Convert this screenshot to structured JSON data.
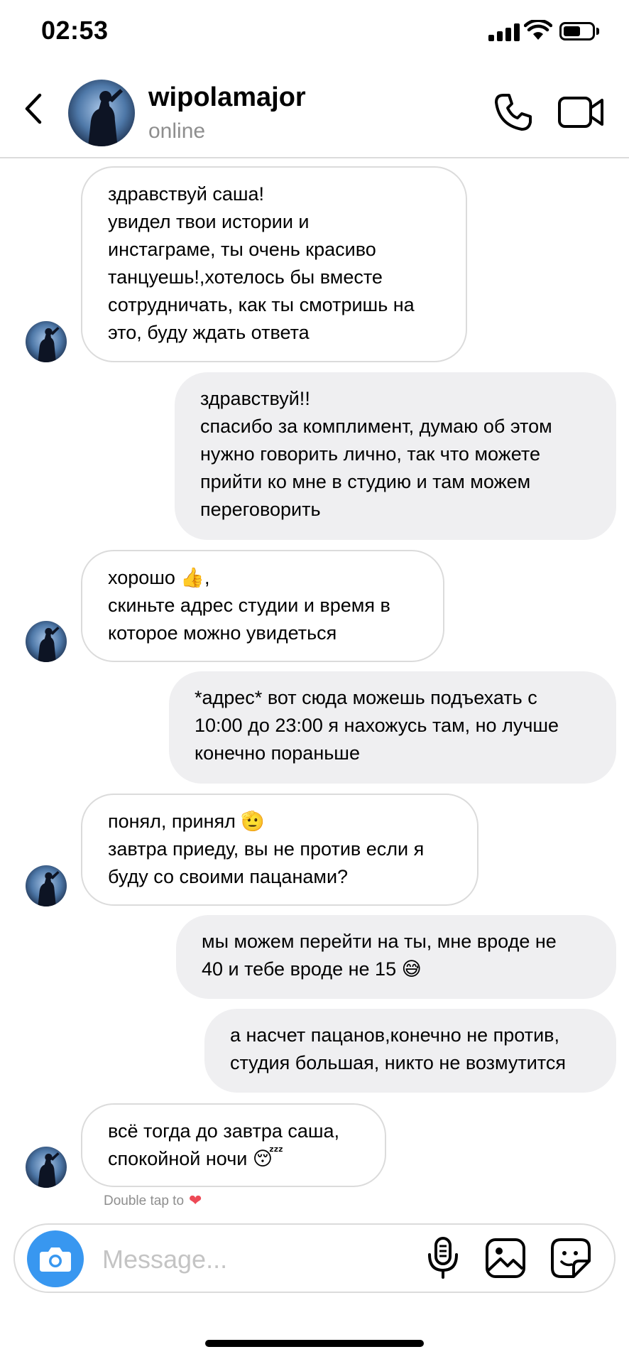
{
  "status_bar": {
    "time": "02:53",
    "battery_level": 0.6
  },
  "header": {
    "username": "wipolamajor",
    "presence": "online",
    "icons": [
      "back-chevron-icon",
      "phone-icon",
      "video-camera-icon"
    ]
  },
  "messages": [
    {
      "from": "them",
      "text": "здравствуй саша!\nувидел твои истории и\nинстаграме, ты очень красиво\nтанцуешь!,хотелось бы вместе\nсотрудничать, как ты смотришь на\nэто, буду ждать ответа"
    },
    {
      "from": "me",
      "text": "здравствуй!!\nспасибо за комплимент, думаю об этом\nнужно говорить лично, так что можете\nприйти ко мне в студию и там можем\nпереговорить"
    },
    {
      "from": "them",
      "text": "хорошо 👍,\nскиньте адрес студии и время в\nкоторое можно увидеться"
    },
    {
      "from": "me",
      "text": "*адрес* вот сюда можешь подъехать с\n10:00 до 23:00 я нахожусь там, но лучше\nконечно пораньше"
    },
    {
      "from": "them",
      "text": "понял, принял 🫡\nзавтра приеду, вы не против если я\nбуду со своими пацанами?"
    },
    {
      "from": "me",
      "text": "мы можем перейти на ты, мне вроде не\n40 и тебе вроде не 15 😅"
    },
    {
      "from": "me",
      "text": "а насчет пацанов,конечно не против,\nстудия большая, никто не возмутится"
    },
    {
      "from": "them",
      "text": "всё тогда до завтра саша,\nспокойной ночи 😴"
    }
  ],
  "double_tap_hint": "Double tap to",
  "heart_glyph": "❤",
  "composer": {
    "placeholder": "Message...",
    "icons": [
      "camera-icon",
      "microphone-icon",
      "gallery-icon",
      "sticker-icon"
    ]
  },
  "colors": {
    "accent": "#3897f0",
    "outgoing_bubble": "#efeff1",
    "bubble_border": "#dbdbdb",
    "muted_text": "#8e8e8e"
  }
}
